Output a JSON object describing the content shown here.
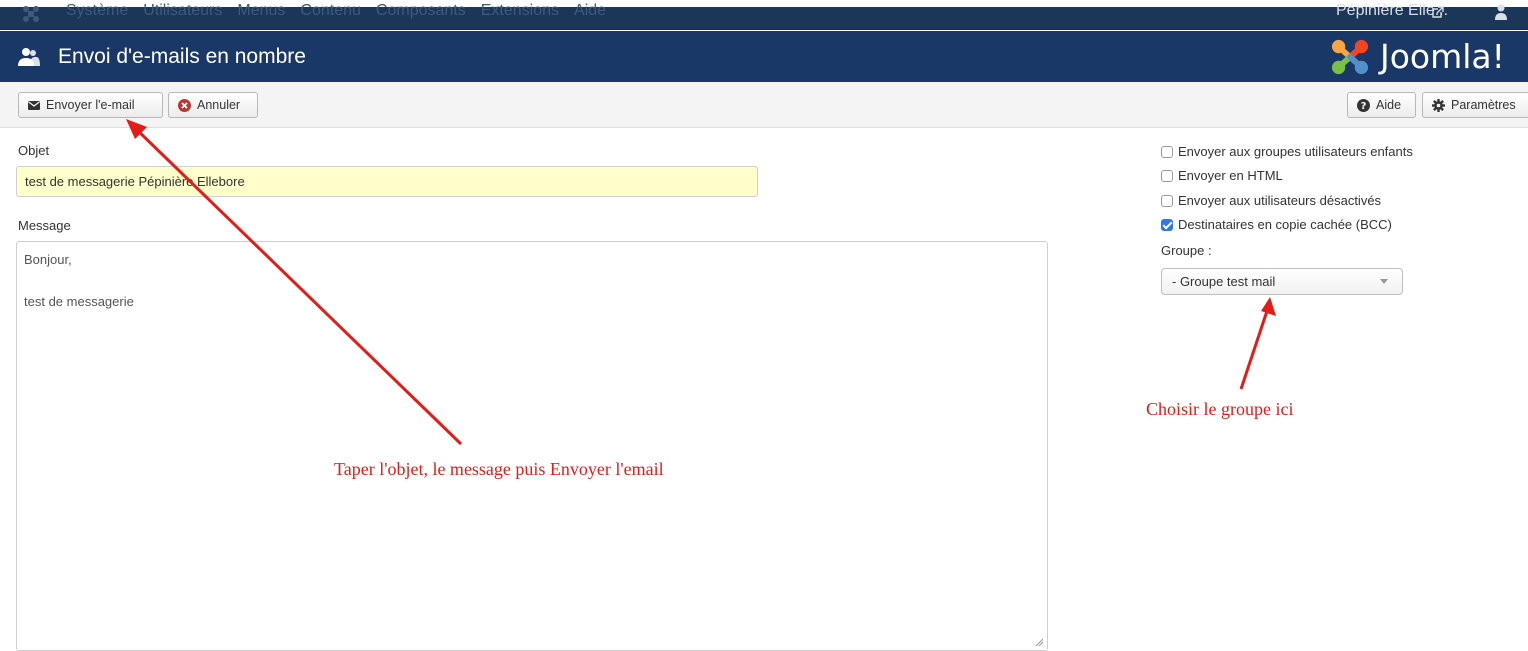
{
  "topbar": {
    "menu": [
      "Système",
      "Utilisateurs",
      "Menus",
      "Contenu",
      "Composants",
      "Extensions",
      "Aide"
    ],
    "site_link": "Pépinière Elle..."
  },
  "titlebar": {
    "title": "Envoi d'e-mails en nombre",
    "logo_text": "Joomla!"
  },
  "toolbar": {
    "send_label": "Envoyer l'e-mail",
    "cancel_label": "Annuler",
    "help_label": "Aide",
    "options_label": "Paramètres"
  },
  "form": {
    "subject_label": "Objet",
    "subject_value": "test de messagerie Pépinière Ellebore",
    "message_label": "Message",
    "message_lines": [
      "Bonjour,",
      "",
      "test de messagerie"
    ]
  },
  "options": {
    "items": [
      {
        "label": "Envoyer aux groupes utilisateurs enfants",
        "checked": false
      },
      {
        "label": "Envoyer en HTML",
        "checked": false
      },
      {
        "label": "Envoyer aux utilisateurs désactivés",
        "checked": false
      },
      {
        "label": "Destinataires en copie cachée (BCC)",
        "checked": true
      }
    ],
    "group_label": "Groupe :",
    "group_selected": "- Groupe test mail"
  },
  "annotations": {
    "left": "Taper l'objet, le message puis Envoyer l'email",
    "right": "Choisir le groupe ici",
    "color": "#e41b17"
  },
  "colors": {
    "topbar": "#1b3658",
    "titlebar": "#1a3867",
    "subject_bg": "#ffffcc",
    "checkbox_checked": "#2b7ae6"
  }
}
